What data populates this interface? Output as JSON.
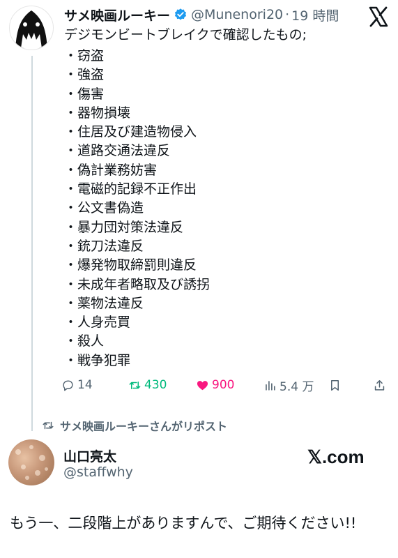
{
  "tweet": {
    "display_name": "サメ映画ルーキー",
    "handle": "@Munenori20",
    "separator": "·",
    "time": "19 時間",
    "intro": "デジモンビートブレイクで確認したもの;",
    "items": [
      "窃盗",
      "強盗",
      "傷害",
      "器物損壊",
      "住居及び建造物侵入",
      "道路交通法違反",
      "偽計業務妨害",
      "電磁的記録不正作出",
      "公文書偽造",
      "暴力団対策法違反",
      "銃刀法違反",
      "爆発物取締罰則違反",
      "未成年者略取及び誘拐",
      "薬物法違反",
      "人身売買",
      "殺人",
      "戦争犯罪"
    ],
    "actions": {
      "replies": "14",
      "reposts": "430",
      "likes": "900",
      "views": "5.4 万"
    }
  },
  "repost_note": "サメ映画ルーキーさんがリポスト",
  "card": {
    "name": "山口亮太",
    "handle": "@staffwhy",
    "brand": "𝕏.com",
    "text": "もう一、二段階上がありますんで、ご期待ください!!"
  },
  "colors": {
    "verified": "#1d9bf0",
    "repost": "#00ba7c",
    "like": "#f91880",
    "muted": "#536471"
  },
  "icons": [
    "shark-avatar",
    "x-logo-icon",
    "verified-badge-icon",
    "reply-icon",
    "repost-icon",
    "like-icon",
    "views-icon",
    "bookmark-icon",
    "share-icon"
  ]
}
